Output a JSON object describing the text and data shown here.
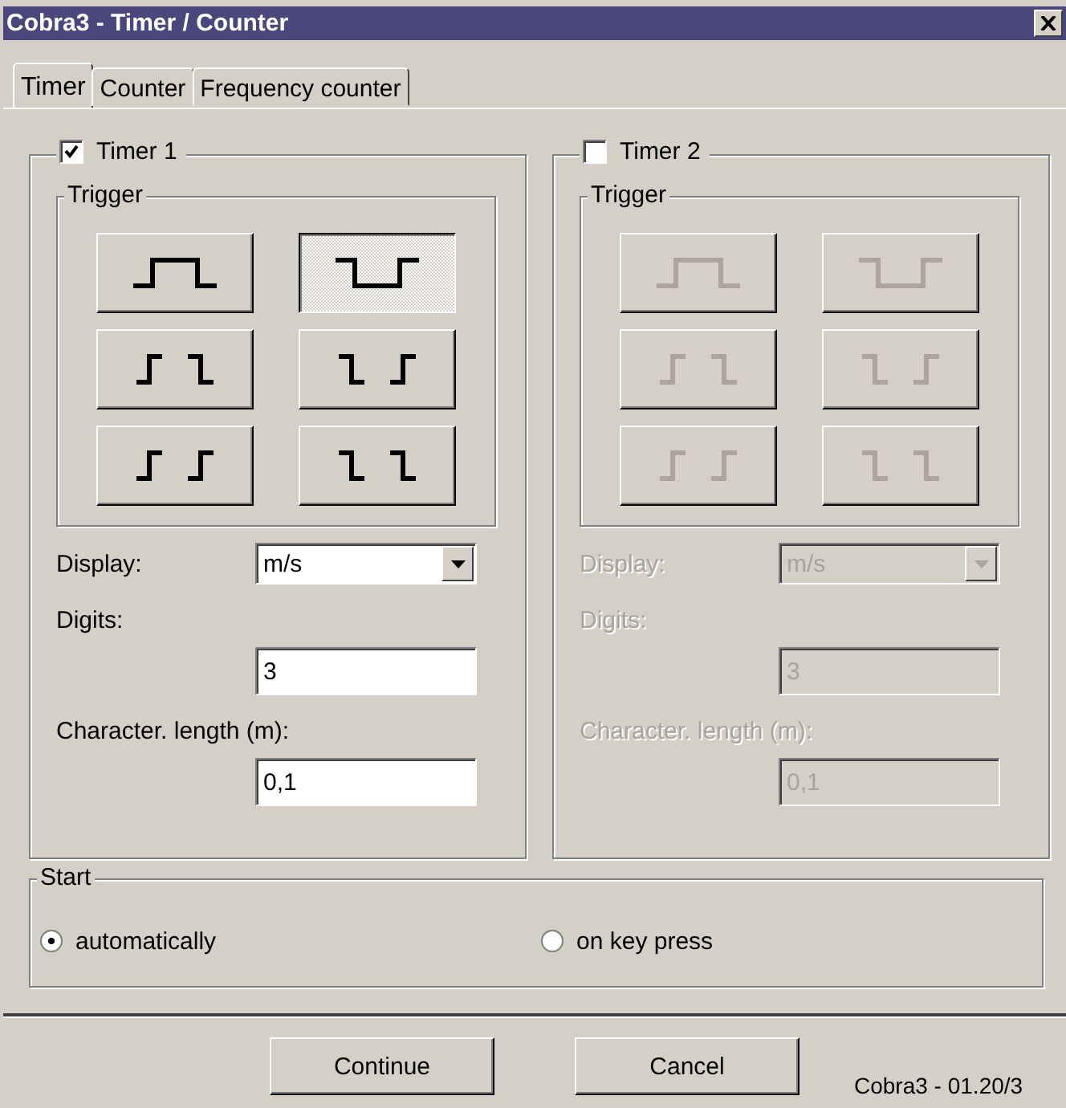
{
  "window": {
    "title": "Cobra3 - Timer / Counter"
  },
  "tabs": [
    {
      "label": "Timer",
      "selected": true
    },
    {
      "label": "Counter",
      "selected": false
    },
    {
      "label": "Frequency counter",
      "selected": false
    }
  ],
  "timers": [
    {
      "label": "Timer 1",
      "checked": true,
      "disabled": false,
      "trigger_title": "Trigger",
      "triggers": [
        {
          "kind": "pulse_high",
          "selected": false
        },
        {
          "kind": "pulse_low",
          "selected": true
        },
        {
          "kind": "rise_fall",
          "selected": false
        },
        {
          "kind": "fall_rise",
          "selected": false
        },
        {
          "kind": "rise_rise",
          "selected": false
        },
        {
          "kind": "fall_fall",
          "selected": false
        }
      ],
      "display_label": "Display:",
      "display_value": "m/s",
      "digits_label": "Digits:",
      "digits_value": "3",
      "length_label": "Character. length (m):",
      "length_value": "0,1"
    },
    {
      "label": "Timer 2",
      "checked": false,
      "disabled": true,
      "trigger_title": "Trigger",
      "triggers": [
        {
          "kind": "pulse_high",
          "selected": false
        },
        {
          "kind": "pulse_low",
          "selected": false
        },
        {
          "kind": "rise_fall",
          "selected": false
        },
        {
          "kind": "fall_rise",
          "selected": false
        },
        {
          "kind": "rise_rise",
          "selected": false
        },
        {
          "kind": "fall_fall",
          "selected": false
        }
      ],
      "display_label": "Display:",
      "display_value": "m/s",
      "digits_label": "Digits:",
      "digits_value": "3",
      "length_label": "Character. length (m):",
      "length_value": "0,1"
    }
  ],
  "start": {
    "title": "Start",
    "options": [
      {
        "label": "automatically",
        "selected": true
      },
      {
        "label": "on key press",
        "selected": false
      }
    ]
  },
  "buttons": [
    "Continue",
    "Cancel"
  ],
  "version": "Cobra3 - 01.20/3"
}
